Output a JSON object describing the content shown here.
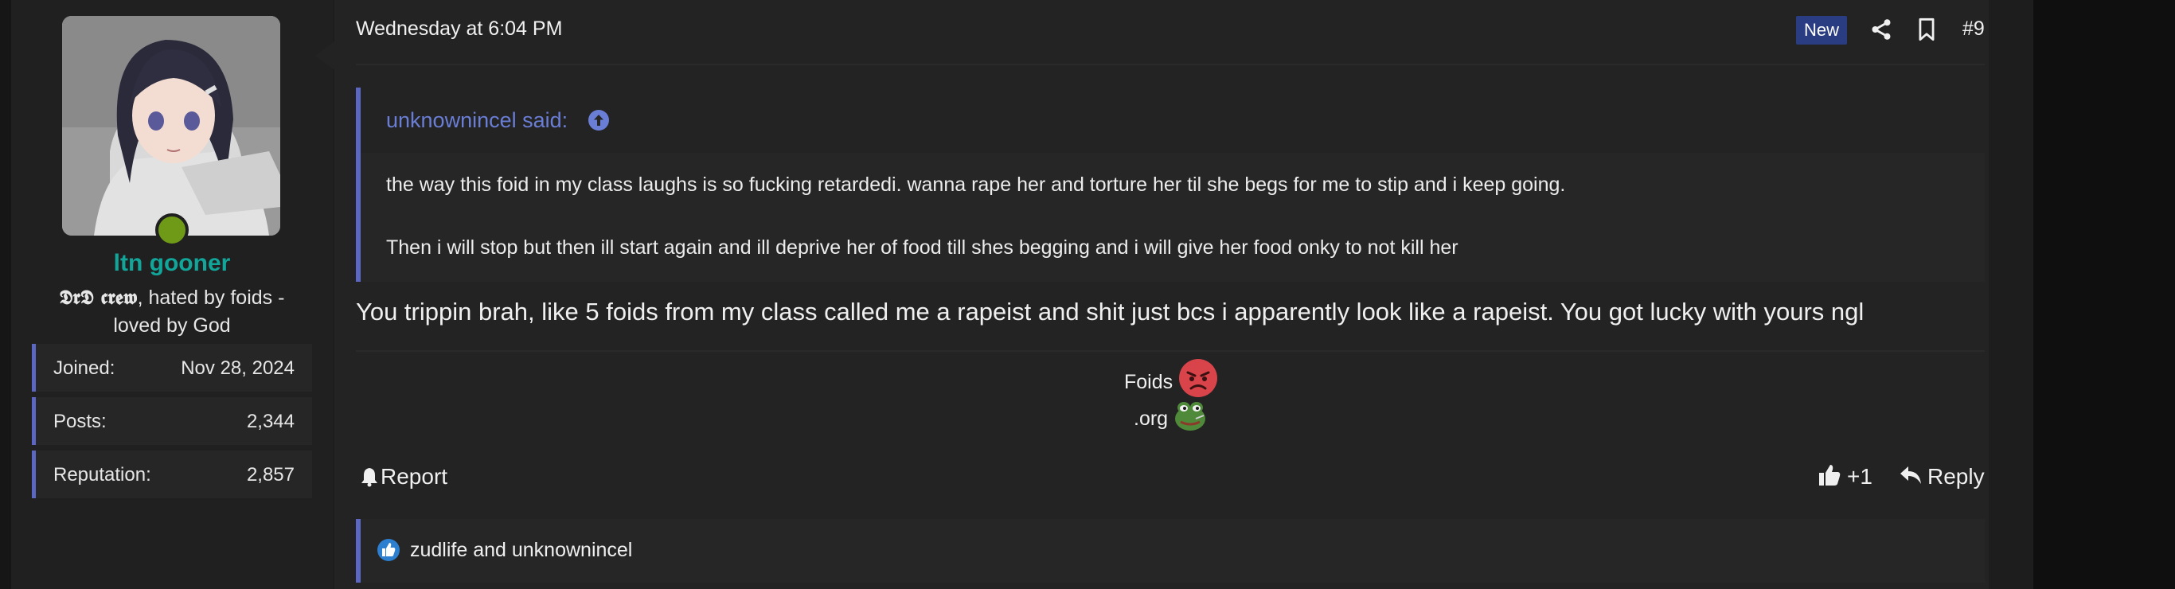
{
  "user": {
    "name": "ltn gooner",
    "title_crew": "𝕯𝖗𝕯 𝖈𝖗𝖊𝖜",
    "title_rest": ", hated by foids - loved by God",
    "stats": [
      {
        "label": "Joined:",
        "value": "Nov 28, 2024"
      },
      {
        "label": "Posts:",
        "value": "2,344"
      },
      {
        "label": "Reputation:",
        "value": "2,857"
      }
    ],
    "online_color": "#6f9a18"
  },
  "post": {
    "date": "Wednesday at 6:04 PM",
    "badge": "New",
    "number": "#9",
    "quote": {
      "author": "unknownincel said:",
      "lines": [
        "the way this foid in my class laughs is so fucking retardedi. wanna rape her and torture her til she begs for me to stip and i keep going.",
        "Then i will stop but then ill start again and ill deprive her of food till shes begging and i will give her food onky to not kill her"
      ]
    },
    "body": "You trippin brah, like 5 foids from my class called me a rapeist and shit just bcs i apparently look like a rapeist. You got lucky with yours ngl",
    "signature": {
      "line1": "Foids",
      "line2": ".org"
    }
  },
  "actions": {
    "report": "Report",
    "like": "+1",
    "reply": "Reply"
  },
  "reactions": {
    "users": "zudlife and unknownincel"
  },
  "colors": {
    "accent": "#5c67c4",
    "username": "#12a59a",
    "quote_author": "#6b7ed6",
    "badge": "#2b3d82"
  },
  "icons": [
    "share-icon",
    "bookmark-icon",
    "arrow-up-circle-icon",
    "angry-face-icon",
    "pepe-frog-icon",
    "bell-icon",
    "thumbs-up-icon",
    "reply-icon"
  ]
}
